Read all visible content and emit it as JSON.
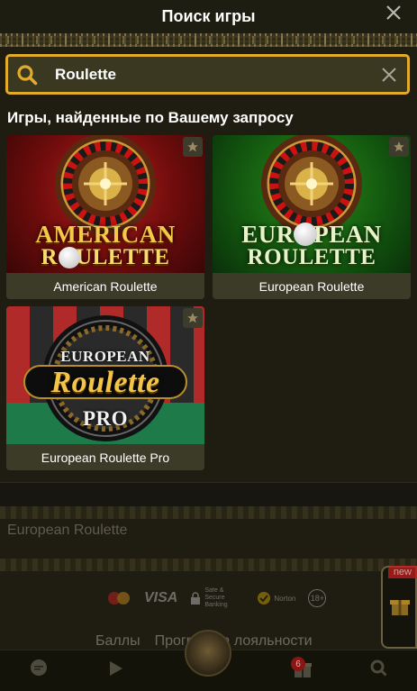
{
  "header": {
    "title": "Поиск игры",
    "close_icon": "close-icon"
  },
  "search": {
    "value": "Roulette",
    "placeholder": "",
    "accent_color": "#e2ab2a",
    "search_icon": "search-icon",
    "clear_icon": "close-icon"
  },
  "results": {
    "heading": "Игры, найденные по Вашему запросу",
    "games": [
      {
        "name": "American Roulette",
        "art_line1": "AMERICAN",
        "art_line2": "ROULETTE",
        "favorite_icon": "star-icon"
      },
      {
        "name": "European Roulette",
        "art_line1": "EUROPEAN",
        "art_line2": "ROULETTE",
        "favorite_icon": "star-icon"
      },
      {
        "name": "European Roulette Pro",
        "art_line1": "EUROPEAN",
        "art_line2": "Roulette",
        "art_line3": "PRO",
        "favorite_icon": "star-icon"
      }
    ]
  },
  "background": {
    "section_title": "European Roulette",
    "footer_links": [
      "Баллы",
      "Программа лояльности"
    ],
    "payment_logos": [
      "mastercard-logo",
      "visa-logo",
      "safe-secure-logo",
      "norton-logo",
      "age-18-logo"
    ],
    "logo_texts": {
      "visa": "VISA",
      "safe": "Safe & Secure Banking",
      "norton": "Norton",
      "age": "18+"
    },
    "new_label": "new",
    "nav_badge_count": "6"
  }
}
